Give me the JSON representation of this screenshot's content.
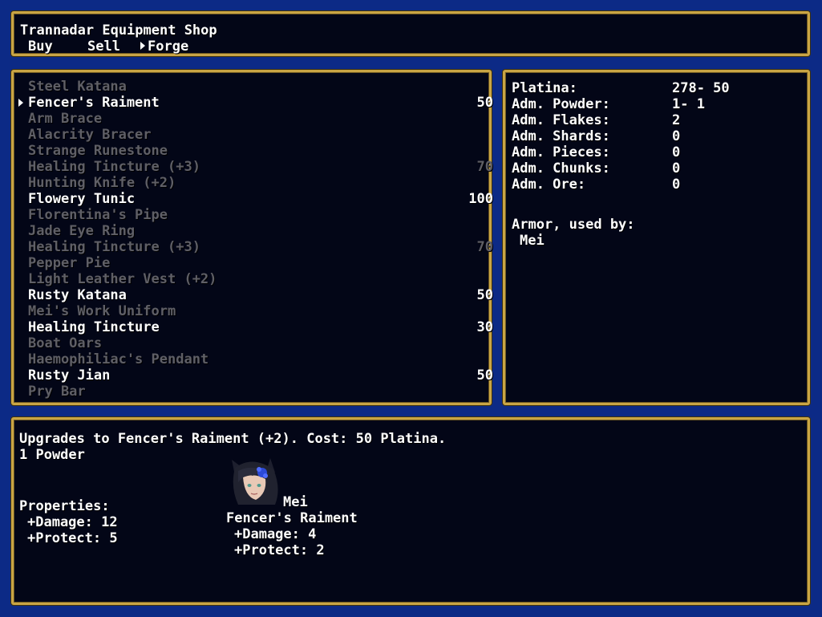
{
  "shop": {
    "title": "Trannadar Equipment Shop",
    "tabs": [
      {
        "label": "Buy"
      },
      {
        "label": "Sell"
      },
      {
        "label": "Forge"
      }
    ]
  },
  "items": [
    {
      "name": "Steel Katana",
      "price": "",
      "enabled": false
    },
    {
      "name": "Fencer's Raiment",
      "price": "50",
      "enabled": true,
      "selected": true
    },
    {
      "name": "Arm Brace",
      "price": "",
      "enabled": false
    },
    {
      "name": "Alacrity Bracer",
      "price": "",
      "enabled": false
    },
    {
      "name": "Strange Runestone",
      "price": "",
      "enabled": false
    },
    {
      "name": "Healing Tincture (+3)",
      "price": "70",
      "enabled": false
    },
    {
      "name": "Hunting Knife (+2)",
      "price": "",
      "enabled": false
    },
    {
      "name": "Flowery Tunic",
      "price": "100",
      "enabled": true
    },
    {
      "name": "Florentina's Pipe",
      "price": "",
      "enabled": false
    },
    {
      "name": "Jade Eye Ring",
      "price": "",
      "enabled": false
    },
    {
      "name": "Healing Tincture (+3)",
      "price": "70",
      "enabled": false
    },
    {
      "name": "Pepper Pie",
      "price": "",
      "enabled": false
    },
    {
      "name": "Light Leather Vest (+2)",
      "price": "",
      "enabled": false
    },
    {
      "name": "Rusty Katana",
      "price": "50",
      "enabled": true
    },
    {
      "name": "Mei's Work Uniform",
      "price": "",
      "enabled": false
    },
    {
      "name": "Healing Tincture",
      "price": "30",
      "enabled": true
    },
    {
      "name": "Boat Oars",
      "price": "",
      "enabled": false
    },
    {
      "name": "Haemophiliac's Pendant",
      "price": "",
      "enabled": false
    },
    {
      "name": "Rusty Jian",
      "price": "50",
      "enabled": true
    },
    {
      "name": "Pry Bar",
      "price": "",
      "enabled": false
    }
  ],
  "materials": [
    {
      "label": "Platina:",
      "value": "278- 50"
    },
    {
      "label": "Adm. Powder:",
      "value": "1- 1"
    },
    {
      "label": "Adm. Flakes:",
      "value": "2"
    },
    {
      "label": "Adm. Shards:",
      "value": "0"
    },
    {
      "label": "Adm. Pieces:",
      "value": "0"
    },
    {
      "label": "Adm. Chunks:",
      "value": "0"
    },
    {
      "label": "Adm. Ore:",
      "value": "0"
    }
  ],
  "usage": {
    "label": "Armor, used by:",
    "users": [
      "Mei"
    ]
  },
  "description": {
    "line1": "Upgrades to Fencer's Raiment (+2). Cost: 50 Platina.",
    "line2": "1 Powder",
    "properties_label": "Properties:",
    "properties": [
      "+Damage: 12",
      "+Protect: 5"
    ],
    "character": {
      "name": "Mei",
      "equipped": "Fencer's Raiment",
      "stats": [
        "+Damage: 4",
        "+Protect: 2"
      ]
    }
  },
  "colors": {
    "background": "#0c2a86",
    "window": "#030617",
    "border": "#c9a545",
    "enabled_text": "#ffffff",
    "disabled_text": "#5f5f66"
  }
}
